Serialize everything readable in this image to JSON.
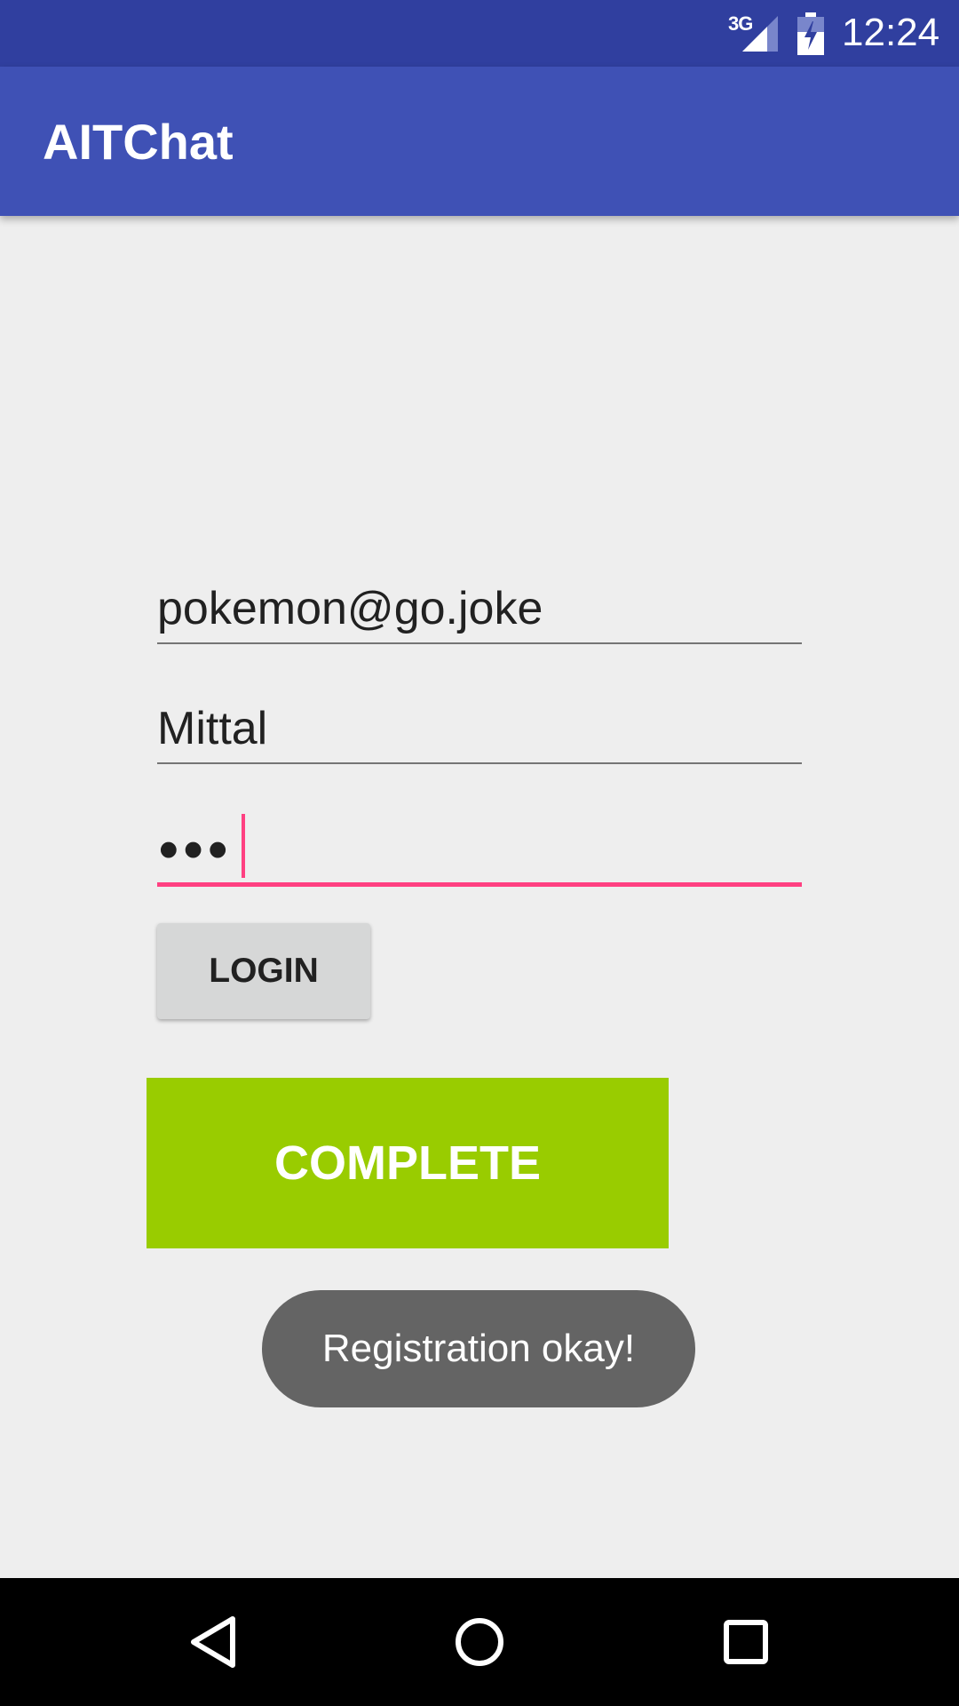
{
  "status_bar": {
    "network": "3G",
    "time": "12:24",
    "signal_icon": "signal-icon",
    "battery_icon": "battery-charging-icon"
  },
  "app_bar": {
    "title": "AITChat"
  },
  "form": {
    "email_value": "pokemon@go.joke",
    "name_value": "Mittal",
    "password_mask": "•••"
  },
  "buttons": {
    "login_label": "LOGIN",
    "complete_label": "COMPLETE"
  },
  "toast": {
    "message": "Registration okay!"
  },
  "nav_bar": {
    "back_icon": "back-icon",
    "home_icon": "home-icon",
    "recents_icon": "recents-icon"
  },
  "colors": {
    "status_bar": "#303f9f",
    "app_bar": "#3f51b5",
    "accent": "#ff4081",
    "complete_button": "#99cc00",
    "toast": "#646464"
  }
}
